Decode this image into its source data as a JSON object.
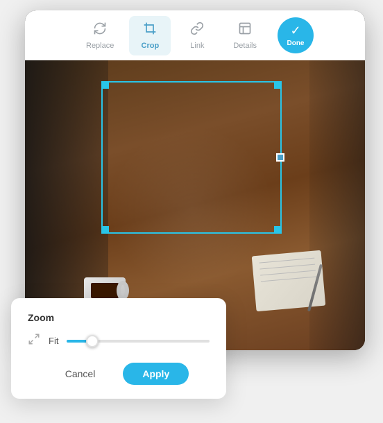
{
  "toolbar": {
    "items": [
      {
        "id": "replace",
        "label": "Replace",
        "icon": "replace"
      },
      {
        "id": "crop",
        "label": "Crop",
        "icon": "crop",
        "active": true
      },
      {
        "id": "link",
        "label": "Link",
        "icon": "link"
      },
      {
        "id": "details",
        "label": "Details",
        "icon": "details"
      }
    ],
    "done_label": "Done"
  },
  "zoom": {
    "title": "Zoom",
    "fit_label": "Fit",
    "slider_value": 20,
    "cancel_label": "Cancel",
    "apply_label": "Apply"
  }
}
